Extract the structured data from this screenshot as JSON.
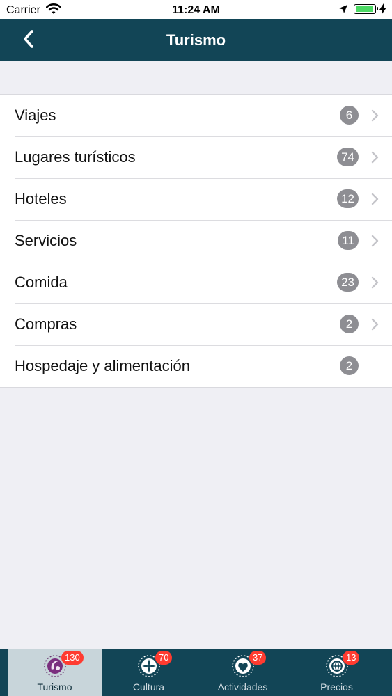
{
  "status_bar": {
    "carrier": "Carrier",
    "time": "11:24 AM",
    "battery_level": 1.0
  },
  "nav": {
    "title": "Turismo"
  },
  "list": {
    "items": [
      {
        "label": "Viajes",
        "count": "6"
      },
      {
        "label": "Lugares turísticos",
        "count": "74"
      },
      {
        "label": "Hoteles",
        "count": "12"
      },
      {
        "label": "Servicios",
        "count": "11"
      },
      {
        "label": "Comida",
        "count": "23"
      },
      {
        "label": "Compras",
        "count": "2"
      },
      {
        "label": "Hospedaje y alimentación",
        "count": "2"
      }
    ]
  },
  "tabs": [
    {
      "label": "Turismo",
      "badge": "130",
      "icon": "turismo-icon",
      "selected": true
    },
    {
      "label": "Cultura",
      "badge": "70",
      "icon": "cultura-icon",
      "selected": false
    },
    {
      "label": "Actividades",
      "badge": "37",
      "icon": "actividades-icon",
      "selected": false
    },
    {
      "label": "Precios",
      "badge": "13",
      "icon": "precios-icon",
      "selected": false
    }
  ],
  "colors": {
    "nav_background": "#124556",
    "badge_gray": "#8e8e93",
    "tab_badge_red": "#ff3b30",
    "battery_green": "#4cd964"
  }
}
